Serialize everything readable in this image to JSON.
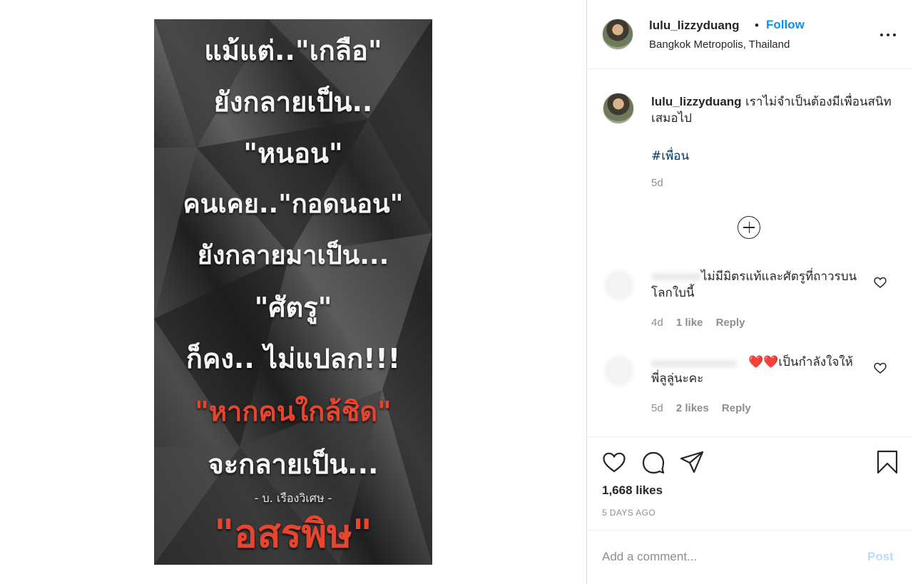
{
  "colors": {
    "accent": "#0095f6",
    "text": "#262626",
    "secondary": "#8e8e8e",
    "hashtag": "#00376b",
    "post_disabled": "#b2dffc",
    "image_red": "#e8452e"
  },
  "header": {
    "username": "lulu_lizzyduang",
    "dot": "•",
    "follow_label": "Follow",
    "location": "Bangkok Metropolis, Thailand",
    "more_icon": "more-options-icon"
  },
  "image_text": [
    "แม้แต่..\"เกลือ\"",
    "ยังกลายเป็น..",
    "\"หนอน\"",
    "คนเคย..\"กอดนอน\"",
    "ยังกลายมาเป็น...",
    "\"ศัตรู\"",
    "ก็คง.. ไม่แปลก!!!",
    "\"หากคนใกล้ชิด\"",
    "จะกลายเป็น...",
    "- บ. เรืองวิเศษ -",
    "\"อสรพิษ\""
  ],
  "caption": {
    "username": "lulu_lizzyduang",
    "text": "เราไม่จำเป็นต้องมีเพื่อนสนิทเสมอไป",
    "hashtag": "#เพื่อน",
    "time": "5d"
  },
  "comments": [
    {
      "text": "ไม่มีมิตรแท้และศัตรูที่ถาวรบนโลกใบนี้",
      "time": "4d",
      "likes": "1 like",
      "reply": "Reply"
    },
    {
      "text": "❤️❤️เป็นกำลังใจให้พี่ลูลู่นะคะ",
      "time": "5d",
      "likes": "2 likes",
      "reply": "Reply"
    }
  ],
  "actions": {
    "likes": "1,668 likes",
    "date": "5 DAYS AGO"
  },
  "add_comment": {
    "placeholder": "Add a comment...",
    "post_label": "Post"
  }
}
